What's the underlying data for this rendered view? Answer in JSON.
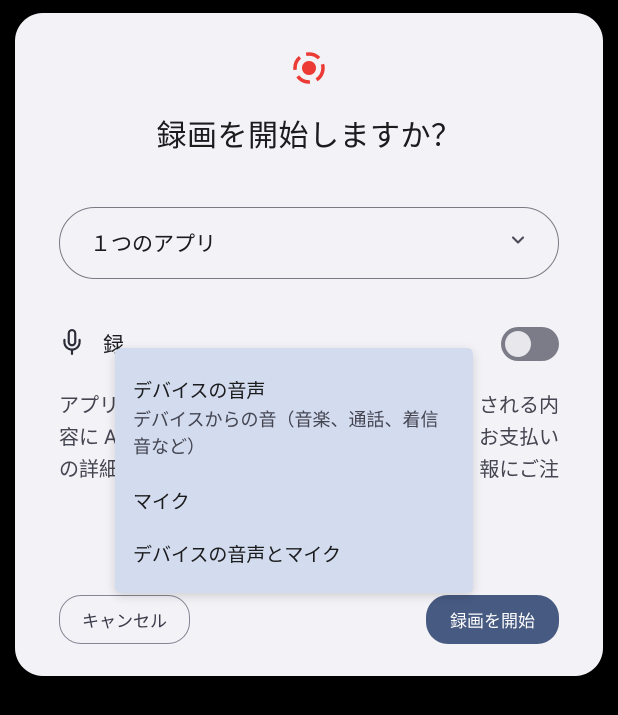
{
  "dialog": {
    "title": "録画を開始しますか？",
    "dropdown": {
      "selected": "１つのアプリ"
    },
    "audio": {
      "label_visible_fragment": "録"
    },
    "description": {
      "line1_pre": "アプリ",
      "line1_post": "される内",
      "line2_pre": "容に A",
      "line2_post": "お支払い",
      "line3_pre": "の詳細",
      "line3_post": "報にご注"
    },
    "popup": {
      "items": [
        {
          "title": "デバイスの音声",
          "subtitle": "デバイスからの音（音楽、通話、着信音など）"
        },
        {
          "title": "マイク",
          "subtitle": ""
        },
        {
          "title": "デバイスの音声とマイク",
          "subtitle": ""
        }
      ]
    },
    "buttons": {
      "cancel": "キャンセル",
      "start": "録画を開始"
    }
  }
}
